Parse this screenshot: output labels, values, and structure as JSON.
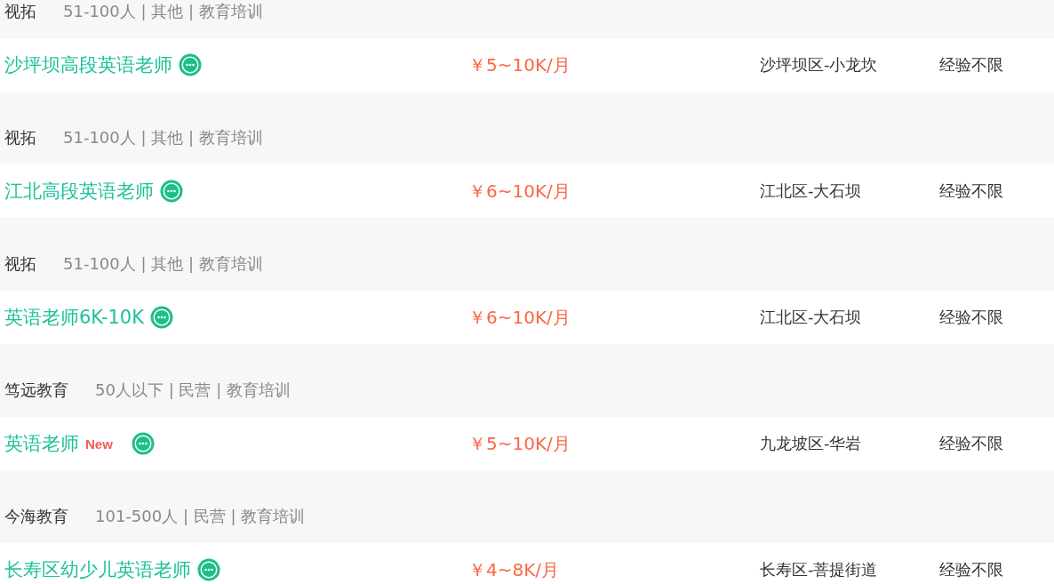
{
  "jobs": [
    {
      "company": "视拓",
      "meta": "51-100人 | 其他 | 教育培训",
      "title": "沙坪坝高段英语老师",
      "salary": "￥5~10K/月",
      "location": "沙坪坝区-小龙坎",
      "experience": "经验不限"
    },
    {
      "company": "视拓",
      "meta": "51-100人 | 其他 | 教育培训",
      "title": "江北高段英语老师",
      "salary": "￥6~10K/月",
      "location": "江北区-大石坝",
      "experience": "经验不限"
    },
    {
      "company": "视拓",
      "meta": "51-100人 | 其他 | 教育培训",
      "title": "英语老师6K-10K",
      "salary": "￥6~10K/月",
      "location": "江北区-大石坝",
      "experience": "经验不限"
    },
    {
      "company": "笃远教育",
      "meta": "50人以下 | 民营 | 教育培训",
      "title": "英语老师",
      "badge": "New",
      "salary": "￥5~10K/月",
      "location": "九龙坡区-华岩",
      "experience": "经验不限"
    },
    {
      "company": "今海教育",
      "meta": "101-500人 | 民营 | 教育培训",
      "title": "长寿区幼少儿英语老师",
      "salary": "￥4~8K/月",
      "location": "长寿区-菩提街道",
      "experience": "经验不限"
    }
  ]
}
